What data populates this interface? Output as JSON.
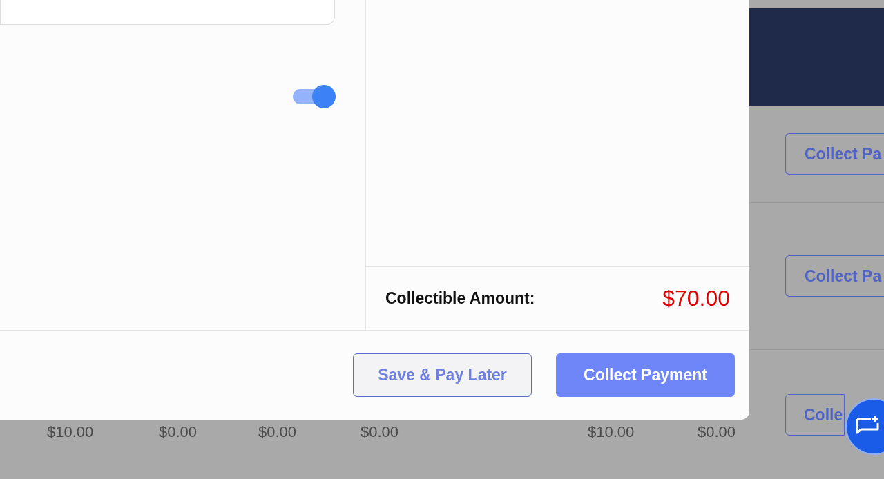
{
  "modal": {
    "toggle": {
      "on": true
    },
    "summary": {
      "label": "Collectible Amount:",
      "amount": "$70.00"
    },
    "buttons": [
      {
        "label": "Save & Pay Later",
        "kind": "secondary"
      },
      {
        "label": "Collect Payment",
        "kind": "primary"
      }
    ]
  },
  "background_table": {
    "rows": [
      {
        "action": "Collect Pa",
        "cells": []
      },
      {
        "action": "Collect Pa",
        "cells": []
      },
      {
        "action": "Colle",
        "cells": [
          "$10.00",
          "$0.00",
          "$0.00",
          "$0.00",
          "$10.00",
          "$0.00"
        ]
      }
    ]
  }
}
